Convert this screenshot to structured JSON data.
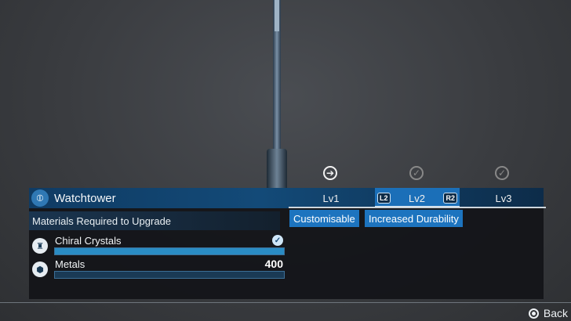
{
  "structure": {
    "icon": "watchtower-icon",
    "title": "Watchtower"
  },
  "levels": [
    {
      "label": "Lv1",
      "status_icon": "arrow-right-icon",
      "state": "current"
    },
    {
      "label": "Lv2",
      "status_icon": "check-icon",
      "state": "selected",
      "left_trigger": "L2",
      "right_trigger": "R2"
    },
    {
      "label": "Lv3",
      "status_icon": "check-icon",
      "state": "locked"
    }
  ],
  "section": {
    "title": "Materials Required to Upgrade"
  },
  "features": [
    "Customisable",
    "Increased Durability"
  ],
  "materials": [
    {
      "name": "Chiral Crystals",
      "icon": "chiral-crystal-icon",
      "requirement": "",
      "status_icon": "check-icon",
      "fill": 1.0
    },
    {
      "name": "Metals",
      "icon": "metals-icon",
      "requirement": "400",
      "status_icon": "",
      "fill": 0.0
    }
  ],
  "footer": {
    "back_label": "Back",
    "back_icon": "circle-button-icon"
  },
  "colors": {
    "accent": "#1d74bf",
    "header": "#134a78"
  }
}
